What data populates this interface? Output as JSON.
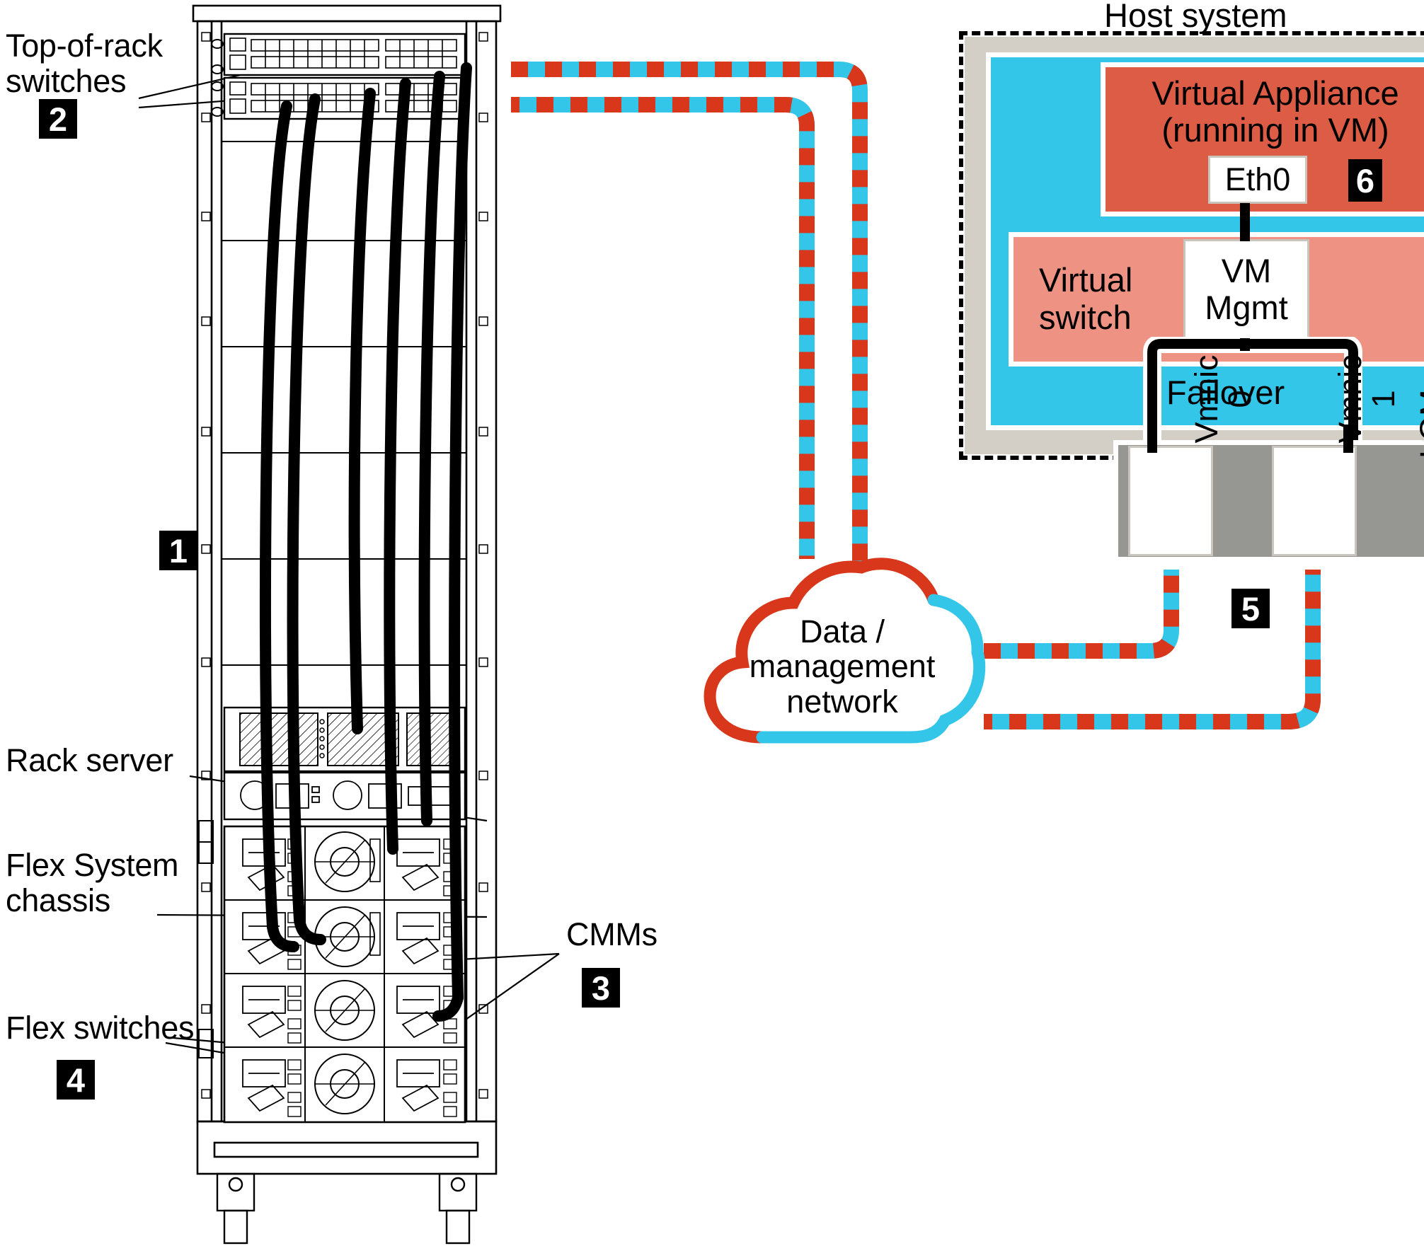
{
  "diagram": {
    "title_host_system": "Host system",
    "labels": {
      "top_of_rack_switches": "Top-of-rack\nswitches",
      "rack_server": "Rack server",
      "flex_system_chassis": "Flex System\nchassis",
      "flex_switches": "Flex switches",
      "cmms": "CMMs"
    },
    "callouts": {
      "rack": "1",
      "top_of_rack_switches": "2",
      "cmms": "3",
      "flex_switches": "4",
      "lom": "5",
      "eth0": "6"
    },
    "cloud": {
      "label": "Data /\nmanagement\nnetwork"
    },
    "host": {
      "virtual_appliance": "Virtual Appliance\n(running in VM)",
      "eth0": "Eth0",
      "virtual_switch": "Virtual\nswitch",
      "vm_mgmt": "VM\nMgmt",
      "failover": "Failover",
      "lom": "LOM",
      "vmnic0": "Vmnic\n0",
      "vmnic1": "Vmnic\n1"
    },
    "colors": {
      "cyan": "#33c6e8",
      "red": "#d8371b",
      "appliance": "#dc5c45",
      "vswitch": "#ee9384",
      "host_bg": "#d3cfc7",
      "lom_bg": "#969692",
      "black": "#000000",
      "white": "#ffffff"
    }
  }
}
